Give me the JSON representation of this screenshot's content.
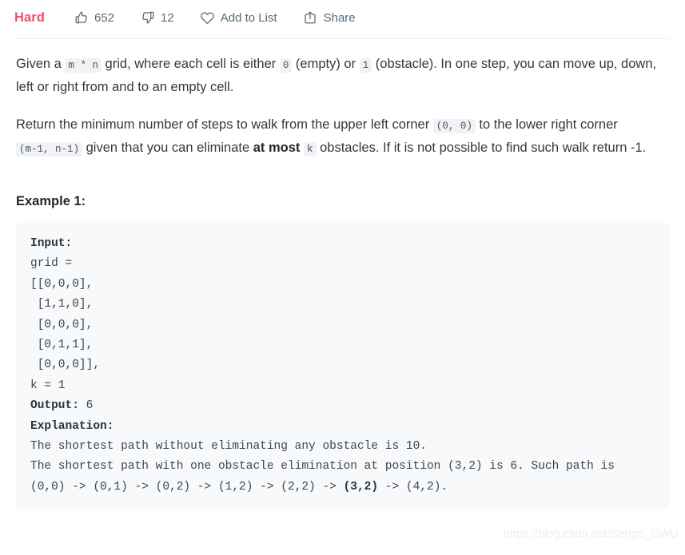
{
  "colors": {
    "difficulty": "#ef4f6d",
    "action_text": "#576a77",
    "body_text": "#333840",
    "code_bg": "#f7f9fa",
    "chip_bg": "#f0f2f5",
    "divider": "#ededed",
    "watermark": "#e9eef1"
  },
  "action_bar": {
    "difficulty": "Hard",
    "likes": {
      "icon": "thumbs-up-icon",
      "count": "652"
    },
    "dislikes": {
      "icon": "thumbs-down-icon",
      "count": "12"
    },
    "add_to_list": {
      "icon": "heart-icon",
      "label": "Add to List"
    },
    "share": {
      "icon": "share-icon",
      "label": "Share"
    }
  },
  "description": {
    "paragraph1": {
      "t1": "Given a ",
      "c1": "m * n",
      "t2": " grid, where each cell is either ",
      "c2": "0",
      "t3": " (empty) or ",
      "c3": "1",
      "t4": " (obstacle). In one step, you can move up, down, left or right from and to an empty cell."
    },
    "paragraph2": {
      "t1": "Return the minimum number of steps to walk from the upper left corner ",
      "c1": "(0, 0)",
      "t2": " to the lower right corner ",
      "c2": "(m-1, n-1)",
      "t3": " given that you can eliminate ",
      "b1": "at most",
      "t4": " ",
      "c3": "k",
      "t5": " obstacles. If it is not possible to find such walk return -1."
    }
  },
  "example": {
    "title": "Example 1:",
    "lines": [
      {
        "type": "bold_label",
        "label": "Input:",
        "rest": ""
      },
      {
        "type": "plain",
        "text": "grid = "
      },
      {
        "type": "plain",
        "text": "[[0,0,0],"
      },
      {
        "type": "plain",
        "text": " [1,1,0],"
      },
      {
        "type": "plain",
        "text": " [0,0,0],"
      },
      {
        "type": "plain",
        "text": " [0,1,1],"
      },
      {
        "type": "plain",
        "text": " [0,0,0]],"
      },
      {
        "type": "plain",
        "text": "k = 1"
      },
      {
        "type": "bold_label",
        "label": "Output:",
        "rest": " 6"
      },
      {
        "type": "bold_label",
        "label": "Explanation:",
        "rest": ""
      },
      {
        "type": "plain",
        "text": "The shortest path without eliminating any obstacle is 10."
      },
      {
        "type": "plain",
        "text": "The shortest path with one obstacle elimination at position (3,2) is 6. Such path is"
      },
      {
        "type": "bold_inline",
        "pre": "(0,0) -> (0,1) -> (0,2) -> (1,2) -> (2,2) -> ",
        "bold": "(3,2)",
        "post": " -> (4,2)."
      }
    ]
  },
  "watermark": {
    "text": "https://blog.csdn.net/Sengo_GWU"
  }
}
